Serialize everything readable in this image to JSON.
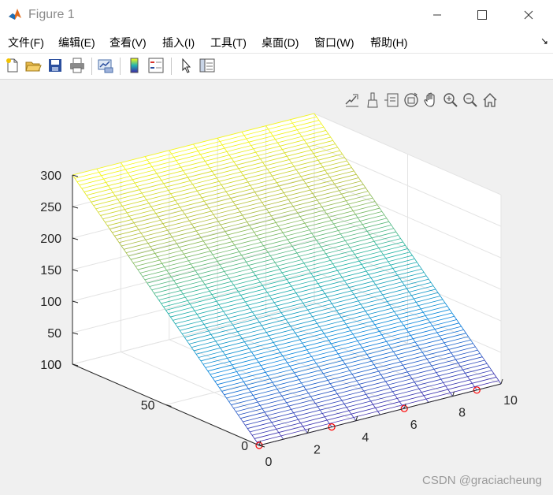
{
  "window": {
    "title": "Figure 1"
  },
  "menu": [
    {
      "label": "文件(F)"
    },
    {
      "label": "编辑(E)"
    },
    {
      "label": "查看(V)"
    },
    {
      "label": "插入(I)"
    },
    {
      "label": "工具(T)"
    },
    {
      "label": "桌面(D)"
    },
    {
      "label": "窗口(W)"
    },
    {
      "label": "帮助(H)"
    }
  ],
  "toolbar": [
    {
      "icon": "new-figure-icon"
    },
    {
      "icon": "open-file-icon"
    },
    {
      "icon": "save-icon"
    },
    {
      "icon": "print-icon"
    },
    {
      "icon": "link-plot-icon"
    },
    {
      "icon": "colorbar-icon"
    },
    {
      "icon": "legend-icon"
    },
    {
      "icon": "edit-plot-icon"
    },
    {
      "icon": "property-inspector-icon"
    }
  ],
  "axes_toolbar": [
    {
      "icon": "export-icon"
    },
    {
      "icon": "brush-icon"
    },
    {
      "icon": "data-tips-icon"
    },
    {
      "icon": "rotate-3d-icon"
    },
    {
      "icon": "pan-icon"
    },
    {
      "icon": "zoom-in-icon"
    },
    {
      "icon": "zoom-out-icon"
    },
    {
      "icon": "home-icon"
    }
  ],
  "chart_data": {
    "type": "surface",
    "style": "mesh",
    "colormap": "parula",
    "x": {
      "ticks": [
        0,
        2,
        4,
        6,
        8,
        10
      ],
      "range": [
        0,
        10
      ]
    },
    "y": {
      "ticks": [
        0,
        50,
        100
      ],
      "range": [
        0,
        100
      ]
    },
    "z": {
      "ticks": [
        0,
        50,
        100,
        150,
        200,
        250,
        300
      ],
      "range": [
        0,
        300
      ]
    },
    "surface_formula": "z = 3*y",
    "grid": true,
    "markers": [
      {
        "x": 0,
        "y": 0,
        "z": 0
      },
      {
        "x": 3,
        "y": 0,
        "z": 0
      },
      {
        "x": 6,
        "y": 0,
        "z": 0
      },
      {
        "x": 9,
        "y": 0,
        "z": 0
      }
    ],
    "marker_color": "#ff0000"
  },
  "watermark": "CSDN @graciacheung"
}
